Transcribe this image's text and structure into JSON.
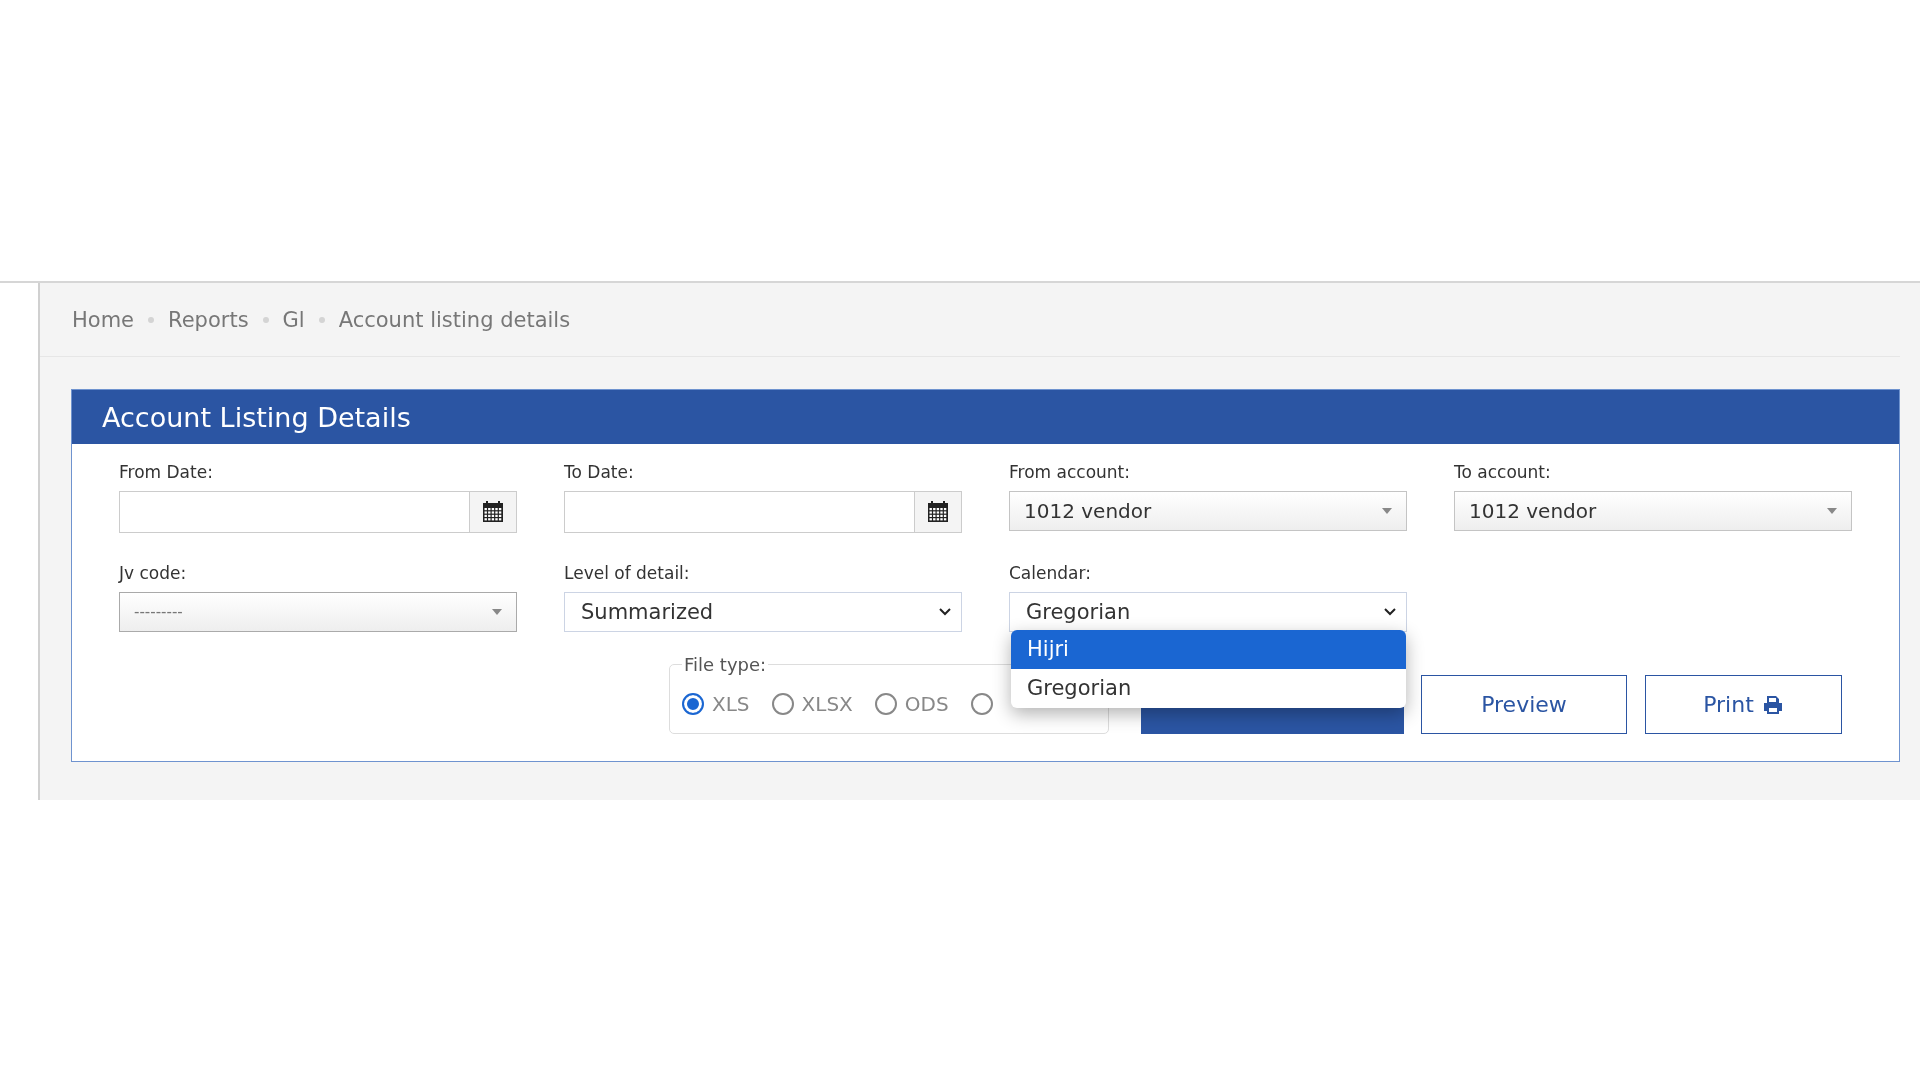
{
  "breadcrumb": [
    {
      "label": "Home"
    },
    {
      "label": "Reports"
    },
    {
      "label": "Gl"
    },
    {
      "label": "Account listing details"
    }
  ],
  "panel": {
    "title": "Account Listing Details"
  },
  "fields": [
    {
      "label": "From Date:",
      "kind": "date"
    },
    {
      "label": "To Date:",
      "kind": "date"
    },
    {
      "label": "From account:",
      "kind": "combo",
      "value": "1012 vendor"
    },
    {
      "label": "To account:",
      "kind": "combo",
      "value": "1012 vendor"
    },
    {
      "label": "Jv code:",
      "kind": "combo-muted",
      "placeholder": "---------"
    },
    {
      "label": "Level of detail:",
      "kind": "select",
      "value": "Summarized"
    },
    {
      "label": "Calendar:",
      "kind": "select",
      "value": "Gregorian",
      "expanded": true,
      "options": [
        {
          "label": "Hijri",
          "highlighted": true
        },
        {
          "label": "Gregorian",
          "highlighted": false
        }
      ]
    }
  ],
  "file_type": {
    "legend": "File type:",
    "options": [
      {
        "label": "XLS",
        "selected": true
      },
      {
        "label": "XLSX",
        "selected": false
      },
      {
        "label": "ODS",
        "selected": false
      },
      {
        "selected": false
      }
    ]
  },
  "buttons": [
    {
      "kind": "download"
    },
    {
      "label": "Preview",
      "kind": "plain"
    },
    {
      "label": "Print",
      "kind": "print"
    }
  ]
}
